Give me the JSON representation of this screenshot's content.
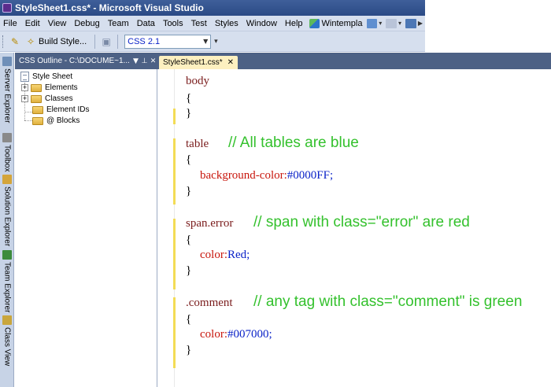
{
  "window": {
    "title": "StyleSheet1.css* - Microsoft Visual Studio"
  },
  "menu": {
    "items": [
      "File",
      "Edit",
      "View",
      "Debug",
      "Team",
      "Data",
      "Tools",
      "Test",
      "Styles",
      "Window",
      "Help"
    ],
    "wintempla": "Wintempla"
  },
  "toolbar": {
    "build_style_label": "Build Style...",
    "css_version": "CSS 2.1"
  },
  "side_tabs": [
    "Server Explorer",
    "Toolbox",
    "Solution Explorer",
    "Team Explorer",
    "Class View"
  ],
  "outline": {
    "title": "CSS Outline - C:\\DOCUME~1...",
    "root": "Style Sheet",
    "items": [
      {
        "label": "Elements",
        "expandable": true
      },
      {
        "label": "Classes",
        "expandable": true
      },
      {
        "label": "Element IDs",
        "expandable": false
      },
      {
        "label": "@ Blocks",
        "expandable": false
      }
    ]
  },
  "editor": {
    "tab_label": "StyleSheet1.css*",
    "blocks": [
      {
        "selector": "body",
        "property": "",
        "value": "",
        "comment": ""
      },
      {
        "selector": "table",
        "property": "background-color:",
        "value": "#0000FF;",
        "comment": "// All tables are blue"
      },
      {
        "selector": "span.error",
        "property": "color:",
        "value": "Red;",
        "comment": "// span with class=\"error\" are red"
      },
      {
        "selector": ".comment",
        "property": "color:",
        "value": "#007000;",
        "comment": "// any tag with class=\"comment\" is green"
      }
    ],
    "open_brace": "{",
    "close_brace": "}"
  },
  "colors": {
    "comment_green": "#34c12d",
    "property_red": "#c8160c",
    "value_blue": "#0a22c8",
    "selector_maroon": "#7a1c1c",
    "tab_panel_header": "#4d6185"
  }
}
